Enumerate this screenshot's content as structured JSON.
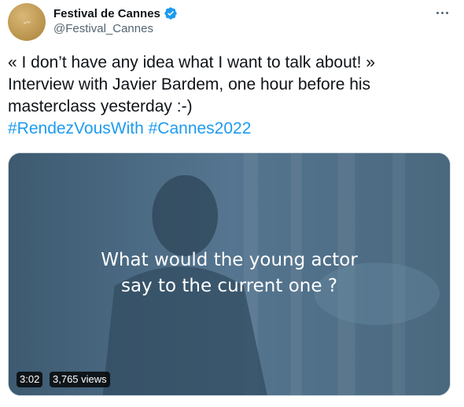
{
  "author": {
    "display_name": "Festival de Cannes",
    "handle": "@Festival_Cannes",
    "avatar_icon": "cannes-palm-logo",
    "verified_icon": "verified-badge-icon",
    "verified_color": "#1d9bf0"
  },
  "tweet": {
    "text_lines": [
      "« I don’t have any idea what I want to talk about! »",
      "Interview with Javier Bardem, one hour before his",
      "masterclass yesterday :-)"
    ],
    "hashtags": [
      "#RendezVousWith",
      "#Cannes2022"
    ],
    "link_color": "#1d9bf0"
  },
  "video": {
    "caption_line1": "What would the young actor",
    "caption_line2": "say to the current one ?",
    "duration": "3:02",
    "views": "3,765 views",
    "tint_color": "#4f6e84"
  }
}
